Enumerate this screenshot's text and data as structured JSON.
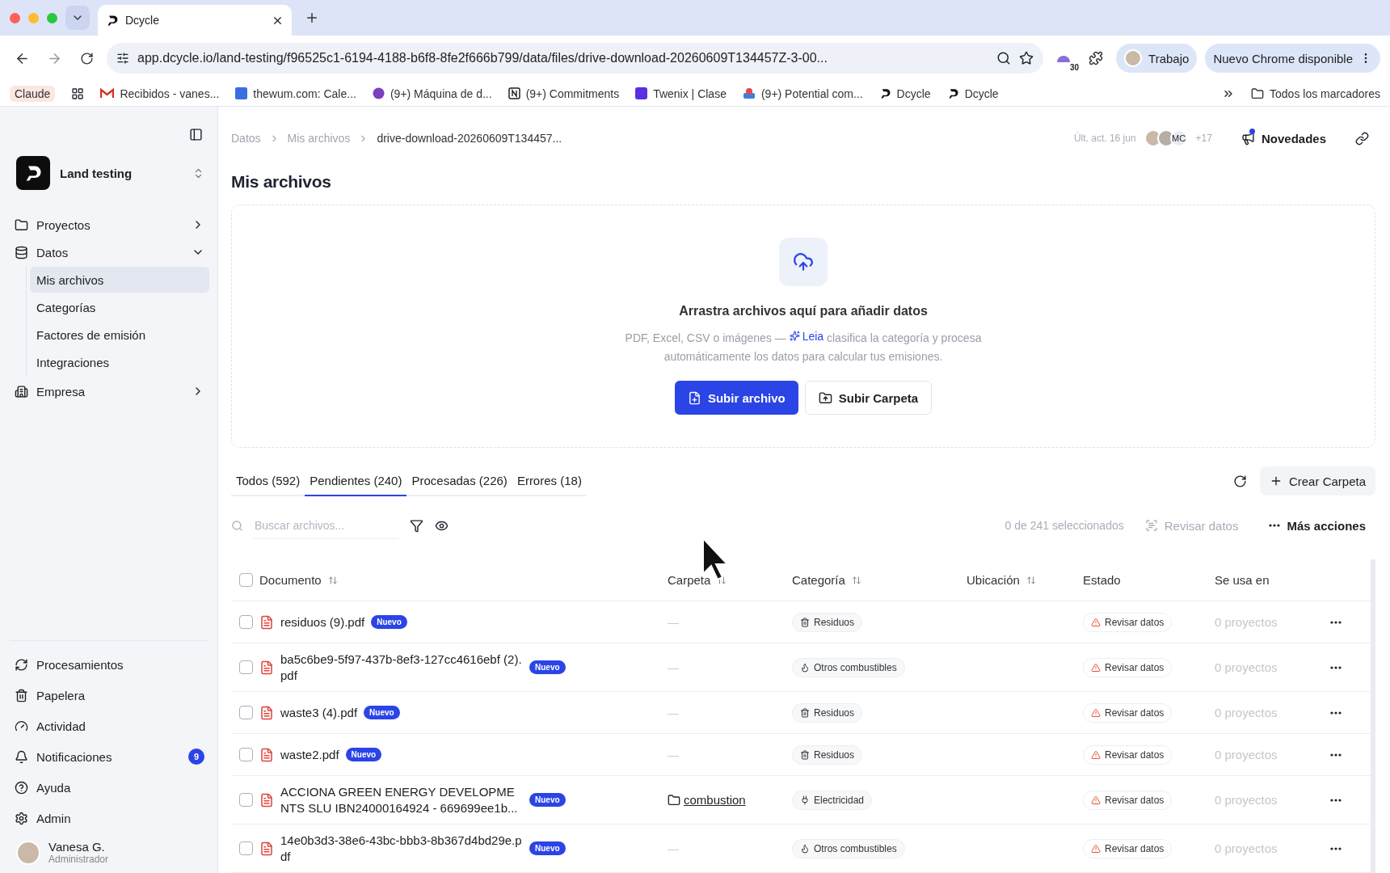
{
  "browser": {
    "tabs": [
      {
        "title": "Dcycle",
        "selected": true
      }
    ],
    "url": "app.dcycle.io/land-testing/f96525c1-6194-4188-b6f8-8fe2f666b799/data/files/drive-download-20260609T134457Z-3-00...",
    "extension_badge": "30",
    "profile": "Trabajo",
    "update": "Nuevo Chrome disponible",
    "bookmarks": [
      "Claude",
      "Recibidos - vanes...",
      "thewum.com: Cale...",
      "(9+) Máquina de d...",
      "(9+) Commitments",
      "Twenix | Clase",
      "(9+) Potential com...",
      "Dcycle",
      "Dcycle"
    ],
    "all_bookmarks": "Todos los marcadores"
  },
  "sidebar": {
    "org": "Land testing",
    "items": [
      {
        "label": "Proyectos",
        "expanded": false
      },
      {
        "label": "Datos",
        "expanded": true,
        "children": [
          {
            "label": "Mis archivos",
            "selected": true
          },
          {
            "label": "Categorías",
            "selected": false
          },
          {
            "label": "Factores de emisión",
            "selected": false
          },
          {
            "label": "Integraciones",
            "selected": false
          }
        ]
      },
      {
        "label": "Empresa",
        "expanded": false
      }
    ],
    "bottom_items": [
      {
        "label": "Procesamientos"
      },
      {
        "label": "Papelera"
      },
      {
        "label": "Actividad"
      },
      {
        "label": "Notificaciones",
        "badge": "9"
      },
      {
        "label": "Ayuda"
      },
      {
        "label": "Admin"
      }
    ],
    "user": {
      "name": "Vanesa G.",
      "role": "Administrador"
    }
  },
  "header": {
    "breadcrumb": [
      "Datos",
      "Mis archivos",
      "drive-download-20260609T134457..."
    ],
    "last_updated": "Últ. act. 16 jun",
    "avatar_initials": "MC",
    "avatar_more": "+17",
    "news": "Novedades"
  },
  "title": "Mis archivos",
  "upload": {
    "title": "Arrastra archivos aquí para añadir datos",
    "desc_before": "PDF, Excel, CSV o imágenes —",
    "leia": "Leia",
    "desc_after": "clasifica la categoría y procesa automáticamente los datos para calcular tus emisiones.",
    "primary": "Subir archivo",
    "secondary": "Subir Carpeta"
  },
  "tabs": [
    {
      "label": "Todos (592)",
      "selected": false
    },
    {
      "label": "Pendientes (240)",
      "selected": true
    },
    {
      "label": "Procesadas (226)",
      "selected": false
    },
    {
      "label": "Errores (18)",
      "selected": false
    }
  ],
  "create_folder": "Crear Carpeta",
  "search": {
    "placeholder": "Buscar archivos..."
  },
  "selection": "0 de 241 seleccionados",
  "review": "Revisar datos",
  "more_actions": "Más acciones",
  "select_all_checked": false,
  "columns": [
    {
      "label": "Documento",
      "sortable": true
    },
    {
      "label": "Carpeta",
      "sortable": true
    },
    {
      "label": "Categoría",
      "sortable": true
    },
    {
      "label": "Ubicación",
      "sortable": true
    },
    {
      "label": "Estado",
      "sortable": false
    },
    {
      "label": "Se usa en",
      "sortable": false
    }
  ],
  "rows": [
    {
      "checked": false,
      "name": "residuos (9).pdf",
      "badge": "Nuevo",
      "folder": "—",
      "folder_link": false,
      "category": {
        "label": "Residuos",
        "kind": "waste"
      },
      "status": "Revisar datos",
      "usage": "0 proyectos"
    },
    {
      "checked": false,
      "name": "ba5c6be9-5f97-437b-8ef3-127cc4616ebf (2).pdf",
      "badge": "Nuevo",
      "folder": "—",
      "folder_link": false,
      "category": {
        "label": "Otros combustibles",
        "kind": "fuel"
      },
      "status": "Revisar datos",
      "usage": "0 proyectos"
    },
    {
      "checked": false,
      "name": "waste3 (4).pdf",
      "badge": "Nuevo",
      "folder": "—",
      "folder_link": false,
      "category": {
        "label": "Residuos",
        "kind": "waste"
      },
      "status": "Revisar datos",
      "usage": "0 proyectos"
    },
    {
      "checked": false,
      "name": "waste2.pdf",
      "badge": "Nuevo",
      "folder": "—",
      "folder_link": false,
      "category": {
        "label": "Residuos",
        "kind": "waste"
      },
      "status": "Revisar datos",
      "usage": "0 proyectos"
    },
    {
      "checked": false,
      "name": "ACCIONA GREEN ENERGY DEVELOPMENTS SLU IBN24000164924 - 669699ee1b...",
      "badge": "Nuevo",
      "folder": "combustion",
      "folder_link": true,
      "category": {
        "label": "Electricidad",
        "kind": "electricity"
      },
      "status": "Revisar datos",
      "usage": "0 proyectos"
    },
    {
      "checked": false,
      "name": "14e0b3d3-38e6-43bc-bbb3-8b367d4bd29e.pdf",
      "badge": "Nuevo",
      "folder": "—",
      "folder_link": false,
      "category": {
        "label": "Otros combustibles",
        "kind": "fuel"
      },
      "status": "Revisar datos",
      "usage": "0 proyectos"
    }
  ]
}
